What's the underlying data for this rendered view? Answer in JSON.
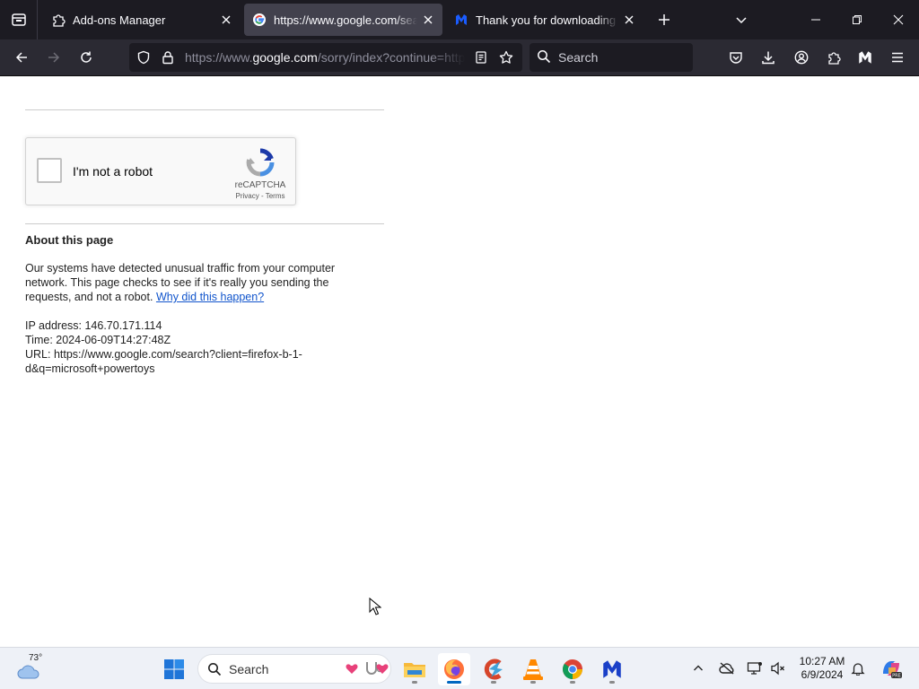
{
  "browser": {
    "tabs": [
      {
        "title": "Add-ons Manager",
        "icon": "puzzle-icon",
        "active": false
      },
      {
        "title": "https://www.google.com/search",
        "icon": "google-icon",
        "active": true
      },
      {
        "title": "Thank you for downloading Malwarebytes",
        "icon": "malwarebytes-icon",
        "active": false
      }
    ],
    "url_prefix": "https://www.",
    "url_domain": "google.com",
    "url_path": "/sorry/index?continue=https://www.google.com/search",
    "search_placeholder": "Search"
  },
  "page": {
    "captcha_label": "I'm not a robot",
    "captcha_brand": "reCAPTCHA",
    "captcha_privacy": "Privacy",
    "captcha_sep": " - ",
    "captcha_terms": "Terms",
    "about_title": "About this page",
    "about_text": "Our systems have detected unusual traffic from your computer network. This page checks to see if it's really you sending the requests, and not a robot. ",
    "about_link": "Why did this happen?",
    "ip_line": "IP address: 146.70.171.114",
    "time_line": "Time: 2024-06-09T14:27:48Z",
    "url_line": "URL: https://www.google.com/search?client=firefox-b-1-d&q=microsoft+powertoys"
  },
  "taskbar": {
    "weather_temp": "73°",
    "search_placeholder": "Search",
    "time": "10:27 AM",
    "date": "6/9/2024",
    "apps": [
      "windows-start-icon",
      "file-explorer-icon",
      "firefox-icon",
      "ccleaner-icon",
      "vlc-icon",
      "chrome-icon",
      "malwarebytes-icon"
    ]
  },
  "colors": {
    "toolbar_bg": "#2b2a33",
    "tabstrip_bg": "#1c1b22",
    "link": "#1155cc",
    "taskbar_bg": "#eef1f7"
  }
}
